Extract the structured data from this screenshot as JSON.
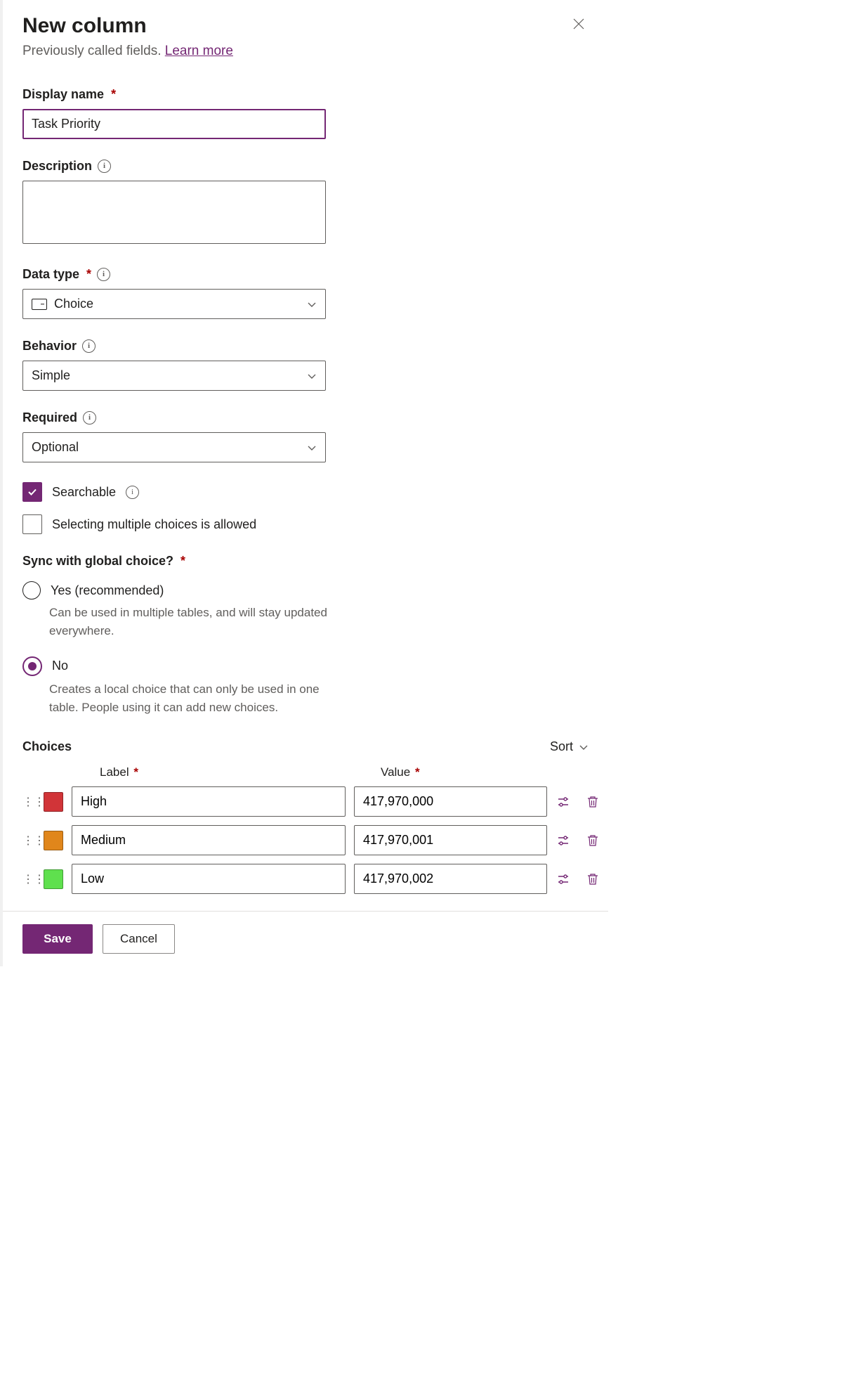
{
  "header": {
    "title": "New column",
    "subtitle_prefix": "Previously called fields. ",
    "learn_more": "Learn more"
  },
  "labels": {
    "display_name": "Display name",
    "description": "Description",
    "data_type": "Data type",
    "behavior": "Behavior",
    "required": "Required",
    "searchable": "Searchable",
    "multi_select": "Selecting multiple choices is allowed",
    "sync_question": "Sync with global choice?",
    "choices": "Choices",
    "sort": "Sort",
    "col_label": "Label",
    "col_value": "Value"
  },
  "values": {
    "display_name": "Task Priority",
    "description": "",
    "data_type": "Choice",
    "behavior": "Simple",
    "required": "Optional",
    "searchable_checked": true,
    "multi_select_checked": false
  },
  "sync": {
    "yes_label": "Yes (recommended)",
    "yes_desc": "Can be used in multiple tables, and will stay updated everywhere.",
    "no_label": "No",
    "no_desc": "Creates a local choice that can only be used in one table. People using it can add new choices.",
    "selected": "no"
  },
  "choices": [
    {
      "label": "High",
      "value": "417,970,000",
      "color": "#d13438"
    },
    {
      "label": "Medium",
      "value": "417,970,001",
      "color": "#e0861b"
    },
    {
      "label": "Low",
      "value": "417,970,002",
      "color": "#5fe04e"
    }
  ],
  "footer": {
    "save": "Save",
    "cancel": "Cancel"
  }
}
